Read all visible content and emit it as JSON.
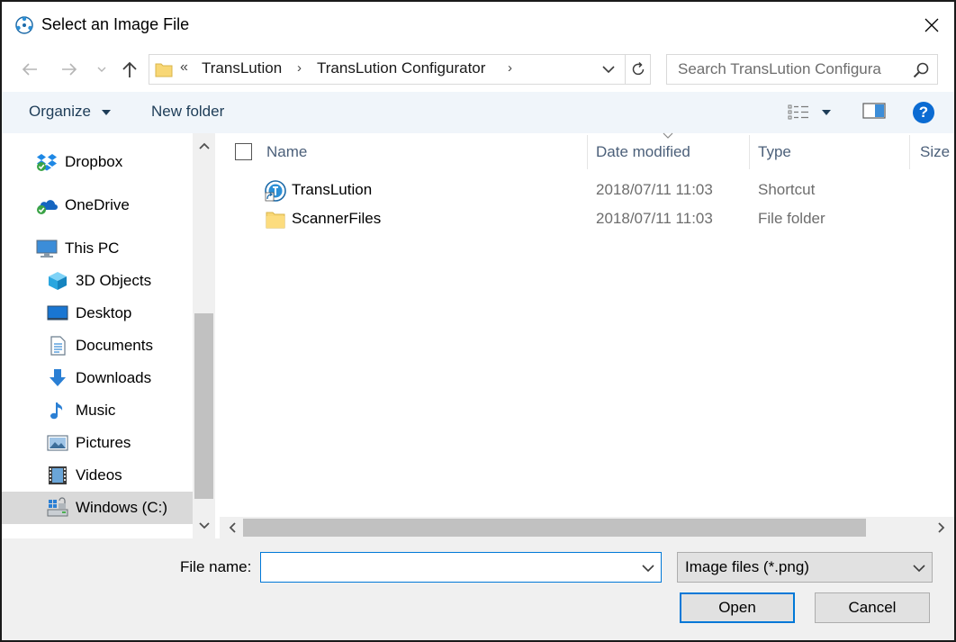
{
  "window": {
    "title": "Select an Image File",
    "close_glyph": "✕"
  },
  "address": {
    "overflow": "«",
    "crumbs": [
      "TransLution",
      "TransLution Configurator"
    ],
    "separator": "›"
  },
  "search": {
    "placeholder": "Search TransLution Configura"
  },
  "toolbar": {
    "organize_label": "Organize",
    "new_folder_label": "New folder",
    "help_label": "?"
  },
  "nav": {
    "items": [
      {
        "label": "Dropbox",
        "icon": "dropbox-icon"
      },
      {
        "label": "OneDrive",
        "icon": "onedrive-icon"
      },
      {
        "label": "This PC",
        "icon": "this-pc-icon"
      },
      {
        "label": "3D Objects",
        "icon": "3d-objects-icon"
      },
      {
        "label": "Desktop",
        "icon": "desktop-icon"
      },
      {
        "label": "Documents",
        "icon": "documents-icon"
      },
      {
        "label": "Downloads",
        "icon": "downloads-icon"
      },
      {
        "label": "Music",
        "icon": "music-icon"
      },
      {
        "label": "Pictures",
        "icon": "pictures-icon"
      },
      {
        "label": "Videos",
        "icon": "videos-icon"
      },
      {
        "label": "Windows (C:)",
        "icon": "drive-icon"
      }
    ],
    "selected": "Windows (C:)"
  },
  "filelist": {
    "columns": [
      "Name",
      "Date modified",
      "Type",
      "Size"
    ],
    "rows": [
      {
        "name": "TransLution",
        "date": "2018/07/11 11:03",
        "type": "Shortcut",
        "icon": "shortcut-icon"
      },
      {
        "name": "ScannerFiles",
        "date": "2018/07/11 11:03",
        "type": "File folder",
        "icon": "folder-icon"
      }
    ]
  },
  "bottom": {
    "file_name_label": "File name:",
    "file_name_value": "",
    "filter_value": "Image files (*.png)",
    "open_label": "Open",
    "cancel_label": "Cancel"
  },
  "colors": {
    "accent": "#0078d7",
    "toolbar_bg": "#f0f5fa",
    "folder_yellow": "#f8d775"
  }
}
